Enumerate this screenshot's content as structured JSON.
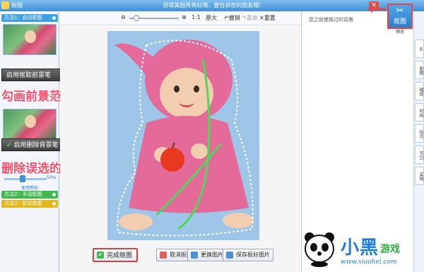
{
  "window": {
    "app_title": "抠图",
    "center_title": "觉得美图秀秀好用，要告诉您的朋友哦!",
    "close_glyph": "✕"
  },
  "left_panel": {
    "method1": "方法1：自动抠图",
    "method2": "方法2：手动抠图",
    "method3": "方法3：形状抠图",
    "slider_value": "50%",
    "help_link": "使用帮助",
    "foreground_button": "启用抠取前景笔",
    "background_button": "启用删除背景笔",
    "check_glyph": "✔"
  },
  "annotations": {
    "foreground": "勾画前景范围",
    "background": "删除误选的抠取范围"
  },
  "toolbar": {
    "zoom_out": "⊖",
    "zoom_in": "⊕",
    "original_size": "1:1",
    "enlarge": "原大",
    "undo": "↶撤销",
    "redo": "↷重做",
    "reset": "✕重置"
  },
  "bottom": {
    "done": "完成抠图",
    "done_check": "✔",
    "cancel": "取消抠图",
    "change_bg": "更换图片",
    "save": "保存抠好图片"
  },
  "right_panel": {
    "title": "您之前使用过的背景",
    "cutout_tool": "抠图",
    "cutout_icon": "✂",
    "preview": "预览",
    "tabs": [
      "⊟",
      "影楼",
      "缩放",
      "时尚",
      "炫光",
      "节日",
      "其他"
    ]
  },
  "logo": {
    "text_main": "小黑",
    "text_secondary": "游戏",
    "url": "www.xiaohei.com"
  },
  "colors": {
    "accent_blue": "#3f8fd6",
    "annotation_pink": "#ff4d6d",
    "method_green": "#3fb84e",
    "method_yellow": "#e3b71a",
    "photo_bg": "#9dc6e8",
    "outfit_pink": "#e46a9a"
  }
}
